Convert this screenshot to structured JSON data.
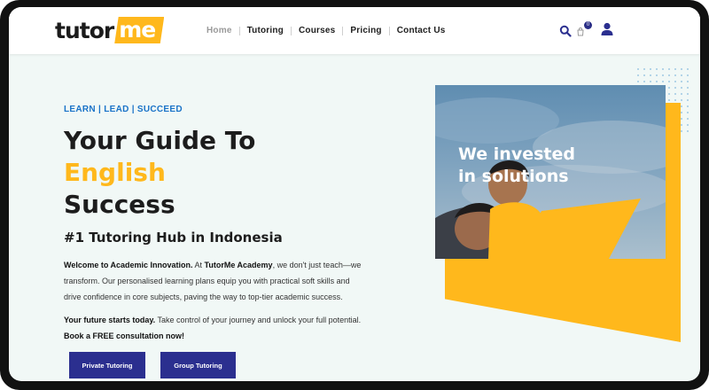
{
  "header": {
    "logo": {
      "part1": "tutor",
      "part2": "me"
    },
    "nav": [
      {
        "label": "Home",
        "active": true
      },
      {
        "label": "Tutoring",
        "active": false
      },
      {
        "label": "Courses",
        "active": false
      },
      {
        "label": "Pricing",
        "active": false
      },
      {
        "label": "Contact Us",
        "active": false
      }
    ],
    "icons": {
      "search": "search-icon",
      "cart": "cart-icon",
      "user": "user-icon"
    },
    "cart_count": "0"
  },
  "hero": {
    "tagline": "LEARN | LEAD | SUCCEED",
    "title_line1": "Your Guide To",
    "title_accent": "English",
    "title_line3": "Success",
    "subheading": "#1 Tutoring Hub in Indonesia",
    "para1_bold1": "Welcome to Academic Innovation.",
    "para1_text1": " At ",
    "para1_bold2": "TutorMe Academy",
    "para1_text2": ", we don't just teach—we transform. Our personalised learning plans equip you with practical soft skills and drive confidence in core subjects, paving the way to top-tier academic success.",
    "para2_bold1": "Your future starts today.",
    "para2_text1": " Take control of your journey and unlock your full potential. ",
    "para2_bold2": "Book a FREE consultation now!",
    "buttons": {
      "private": "Private Tutoring",
      "group": "Group Tutoring"
    },
    "image_caption_line1": "We invested",
    "image_caption_line2": "in solutions"
  },
  "colors": {
    "brand_yellow": "#ffb81c",
    "brand_navy": "#2b2f8f",
    "link_blue": "#1a73c8",
    "background": "#f1f8f6"
  }
}
